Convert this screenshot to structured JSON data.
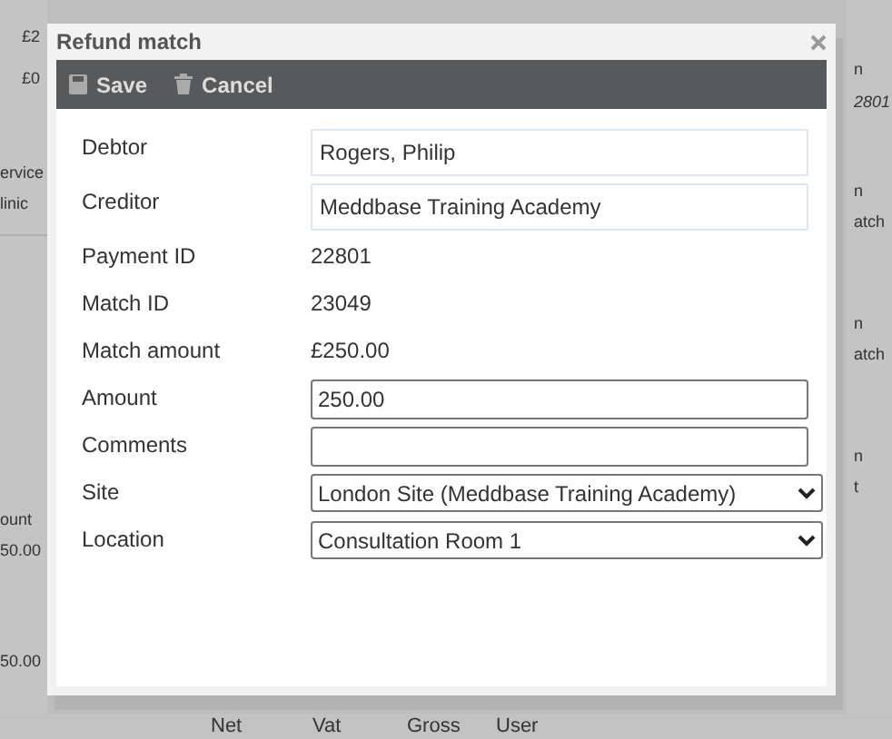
{
  "background": {
    "left_fragments": [
      "£2",
      "£0",
      "ervice",
      "linic",
      "ount",
      "50.00",
      "50.00"
    ],
    "right_fragments": [
      "n",
      "2801",
      "n",
      "atch",
      "n",
      "atch",
      "n",
      "t"
    ],
    "footer_columns": [
      "Net",
      "Vat",
      "Gross",
      "User"
    ]
  },
  "dialog": {
    "title": "Refund match",
    "toolbar": [
      {
        "label": "Save",
        "kind": "save"
      },
      {
        "label": "Cancel",
        "kind": "cancel"
      }
    ],
    "fields": [
      {
        "label": "Debtor",
        "kind": "readonly",
        "value": "Rogers, Philip"
      },
      {
        "label": "Creditor",
        "kind": "readonly",
        "value": "Meddbase Training Academy"
      },
      {
        "label": "Payment ID",
        "kind": "text",
        "value": "22801"
      },
      {
        "label": "Match ID",
        "kind": "text",
        "value": "23049"
      },
      {
        "label": "Match amount",
        "kind": "text",
        "value": "£250.00"
      },
      {
        "label": "Amount",
        "kind": "input",
        "value": "250.00"
      },
      {
        "label": "Comments",
        "kind": "input"
      },
      {
        "label": "Site",
        "kind": "select",
        "value": "London Site (Meddbase Training Academy)"
      },
      {
        "label": "Location",
        "kind": "select",
        "value": "Consultation Room 1"
      }
    ]
  }
}
